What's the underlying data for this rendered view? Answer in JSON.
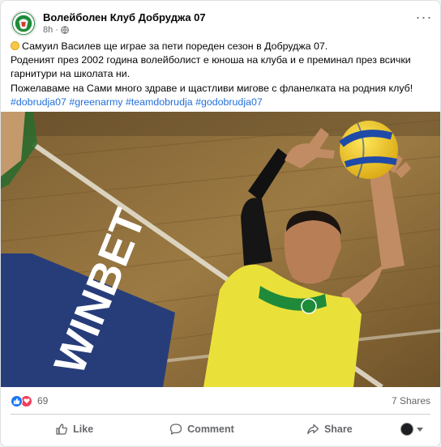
{
  "post": {
    "page_name": "Волейболен Клуб Добруджа 07",
    "time": "8h",
    "privacy_icon": "globe-icon",
    "more_icon": "more-horizontal-icon",
    "lines": [
      "Самуил Василев ще играе за пети пореден сезон в Добруджа 07.",
      "Роденият през 2002 година волейболист е юноша на клуба и е преминал през всички",
      "гарнитури на школата ни.",
      "Пожелаваме на Сами много здраве и щастливи мигове с фланелката на родния клуб!"
    ],
    "hashtags": [
      "#dobrudja07",
      "#greenarmy",
      "#teamdobrudja",
      "#godobrudja07"
    ],
    "photo_sign_text": "WINBET"
  },
  "stats": {
    "reaction_icons": [
      "like-reaction-icon",
      "love-reaction-icon"
    ],
    "reaction_count": "69",
    "shares": "7 Shares"
  },
  "actions": {
    "like": "Like",
    "comment": "Comment",
    "share": "Share"
  },
  "colors": {
    "link": "#216fdb",
    "muted": "#65676b",
    "like_blue": "#1877f2",
    "love_red": "#f33e58",
    "jersey_yellow": "#e9e13a",
    "jersey_green": "#1f8a3a"
  }
}
